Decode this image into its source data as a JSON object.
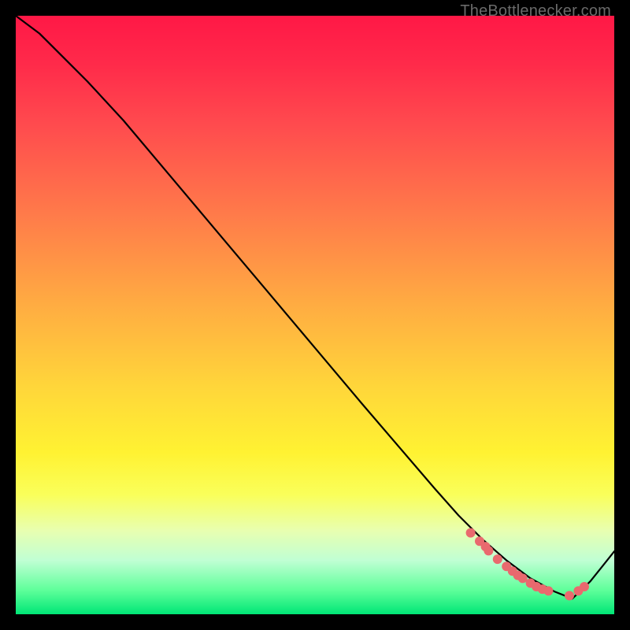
{
  "watermark": "TheBottlenecker.com",
  "chart_data": {
    "type": "line",
    "title": "",
    "xlabel": "",
    "ylabel": "",
    "xlim": [
      0,
      100
    ],
    "ylim": [
      0,
      100
    ],
    "curve": {
      "x": [
        0,
        4,
        8,
        12,
        18,
        26,
        34,
        42,
        50,
        58,
        64,
        70,
        74,
        78,
        82,
        86,
        90,
        93,
        96,
        100
      ],
      "y": [
        100,
        97,
        93,
        89,
        82.5,
        73,
        63.5,
        54,
        44.5,
        35,
        28,
        21,
        16.5,
        12.5,
        9,
        6,
        3.8,
        2.6,
        5.5,
        10.5
      ]
    },
    "scatter": {
      "x": [
        76,
        77.5,
        78.5,
        79,
        80.5,
        82,
        83,
        83.9,
        84.7,
        86,
        87,
        88,
        89,
        92.5,
        94,
        95
      ],
      "y": [
        13.6,
        12.2,
        11.3,
        10.6,
        9.2,
        8,
        7.2,
        6.5,
        6,
        5.2,
        4.6,
        4.2,
        3.9,
        3.1,
        3.9,
        4.6
      ]
    }
  }
}
